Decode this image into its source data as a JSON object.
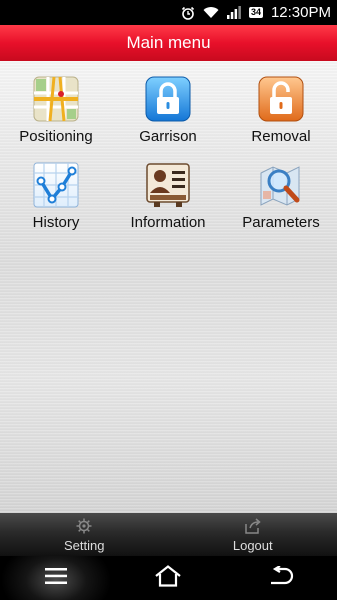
{
  "status_bar": {
    "battery_level": "34",
    "time": "12:30PM",
    "icons": [
      "alarm-icon",
      "wifi-icon",
      "signal-icon",
      "battery-icon"
    ]
  },
  "header": {
    "title": "Main menu",
    "color": "#e8102a"
  },
  "menu": {
    "items": [
      {
        "label": "Positioning",
        "icon": "map-pin-icon"
      },
      {
        "label": "Garrison",
        "icon": "lock-closed-icon"
      },
      {
        "label": "Removal",
        "icon": "lock-open-icon"
      },
      {
        "label": "History",
        "icon": "route-history-icon"
      },
      {
        "label": "Information",
        "icon": "contact-card-icon"
      },
      {
        "label": "Parameters",
        "icon": "search-map-icon"
      }
    ]
  },
  "bottom_bar": {
    "setting_label": "Setting",
    "logout_label": "Logout"
  },
  "nav_bar": {
    "icons": [
      "menu-icon",
      "home-icon",
      "back-icon"
    ]
  }
}
